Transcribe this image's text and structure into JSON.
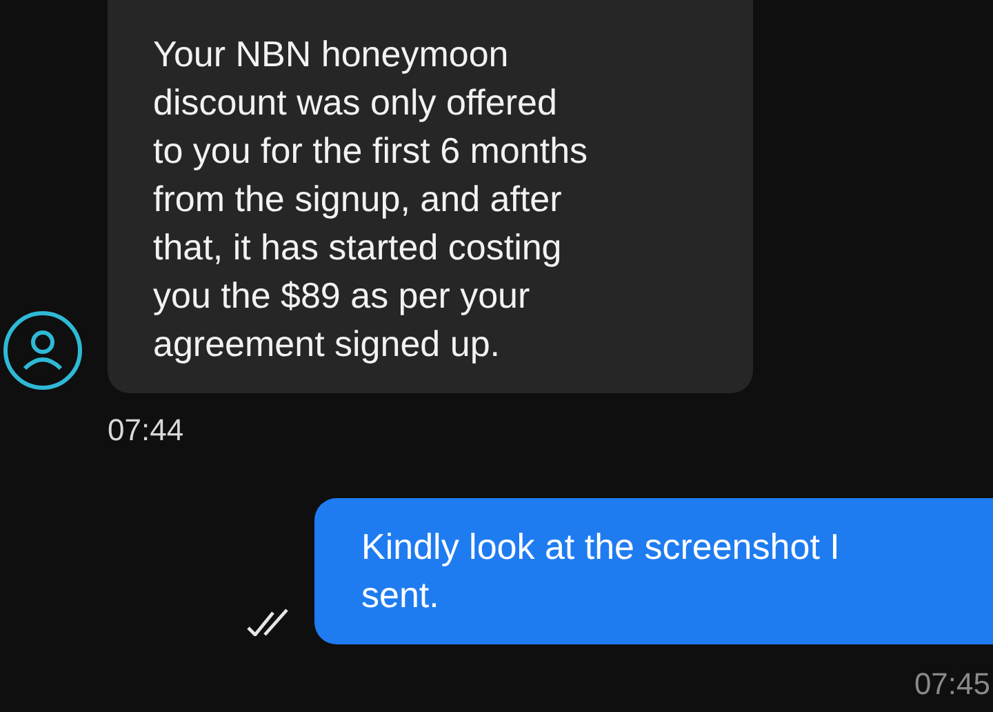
{
  "messages": [
    {
      "kind": "incoming",
      "text": "Your NBN honeymoon\ndiscount was only offered\nto you for the first 6 months\nfrom the signup, and after\nthat, it has started costing\nyou the $89 as per your\nagreement signed up.",
      "time": "07:44"
    },
    {
      "kind": "outgoing",
      "text": "Kindly look at the screenshot I\nsent.",
      "time": "07:45",
      "read": true
    }
  ]
}
